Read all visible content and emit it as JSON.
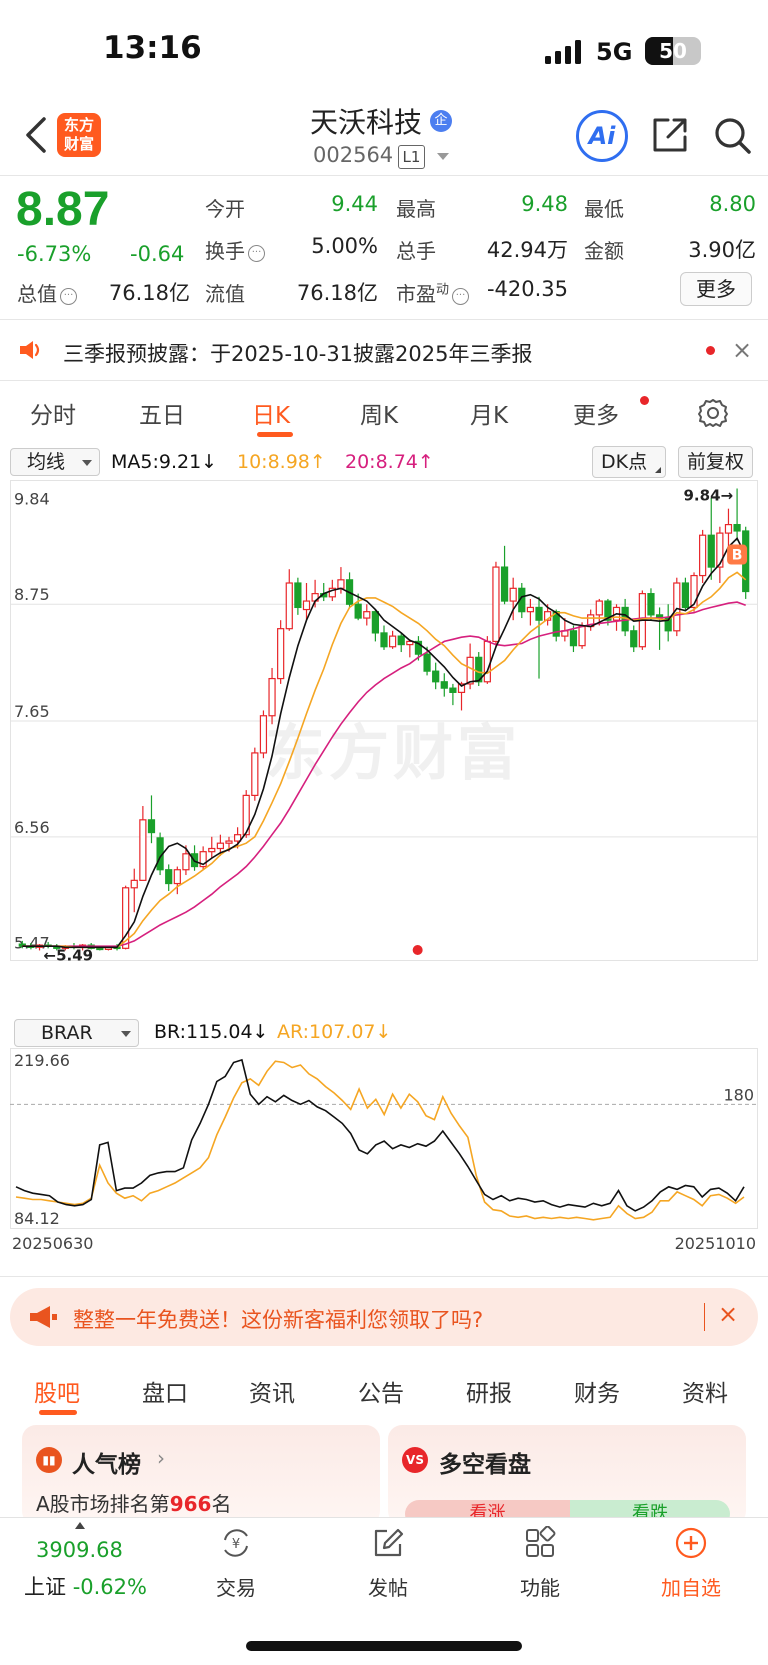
{
  "status_bar": {
    "time": "13:16",
    "network": "5G",
    "battery": "50",
    "battery_level": 0.5
  },
  "header": {
    "back_label": "",
    "logo_text": "东方\n财富",
    "stock_name": "天沃科技",
    "stock_badge": "企",
    "stock_code": "002564",
    "level_badge": "L1",
    "ai_label": "Ai"
  },
  "quote": {
    "price": "8.87",
    "change_pct": "-6.73%",
    "change_val": "-0.64",
    "fields": [
      {
        "label": "今开",
        "value": "9.44",
        "green": true
      },
      {
        "label": "最高",
        "value": "9.48",
        "green": true
      },
      {
        "label": "最低",
        "value": "8.80",
        "green": true
      },
      {
        "label": "换手",
        "value": "5.00%",
        "green": false,
        "info": true
      },
      {
        "label": "总手",
        "value": "42.94万",
        "green": false
      },
      {
        "label": "金额",
        "value": "3.90亿",
        "green": false
      },
      {
        "label": "总值",
        "value": "76.18亿",
        "green": false,
        "info": true
      },
      {
        "label": "流值",
        "value": "76.18亿",
        "green": false
      },
      {
        "label": "市盈",
        "sup": "动",
        "value": "-420.35",
        "green": false,
        "info": true
      }
    ],
    "more_label": "更多"
  },
  "notice": {
    "text": "三季报预披露：于2025-10-31披露2025年三季报",
    "close": "×"
  },
  "period_tabs": [
    "分时",
    "五日",
    "日K",
    "周K",
    "月K",
    "更多"
  ],
  "ma_legend": {
    "select": "均线",
    "ma5": "MA5:9.21↓",
    "ma10": "10:8.98↑",
    "ma20": "20:8.74↑",
    "dk_label": "DK点",
    "fq_label": "前复权"
  },
  "colors": {
    "up": "#e8262a",
    "down": "#1aa02b",
    "ma5": "#111111",
    "ma10": "#f5a623",
    "ma20": "#d6207e",
    "accent": "#ff5a1f",
    "br": "#111111",
    "ar": "#f5a623"
  },
  "chart_data": [
    {
      "type": "candlestick",
      "title": "",
      "y_ticks": [
        "9.84",
        "8.75",
        "7.65",
        "6.56",
        "5.47"
      ],
      "ylim": [
        5.4,
        9.92
      ],
      "annotations": {
        "high_label": "9.84→",
        "low_label": "←5.49",
        "buy_marker": "B"
      },
      "candles_ohlc": [
        [
          5.55,
          5.58,
          5.51,
          5.53
        ],
        [
          5.53,
          5.56,
          5.5,
          5.52
        ],
        [
          5.52,
          5.55,
          5.49,
          5.54
        ],
        [
          5.54,
          5.57,
          5.51,
          5.53
        ],
        [
          5.53,
          5.55,
          5.49,
          5.51
        ],
        [
          5.51,
          5.54,
          5.49,
          5.53
        ],
        [
          5.53,
          5.56,
          5.5,
          5.52
        ],
        [
          5.52,
          5.55,
          5.49,
          5.54
        ],
        [
          5.54,
          5.56,
          5.5,
          5.51
        ],
        [
          5.51,
          5.53,
          5.49,
          5.5
        ],
        [
          5.5,
          5.53,
          5.49,
          5.52
        ],
        [
          5.52,
          5.55,
          5.49,
          5.51
        ],
        [
          5.51,
          6.1,
          5.5,
          6.08
        ],
        [
          6.08,
          6.26,
          5.85,
          6.15
        ],
        [
          6.15,
          6.85,
          6.15,
          6.72
        ],
        [
          6.72,
          6.95,
          6.5,
          6.6
        ],
        [
          6.55,
          6.6,
          6.2,
          6.25
        ],
        [
          6.25,
          6.3,
          6.05,
          6.12
        ],
        [
          6.12,
          6.28,
          6.02,
          6.25
        ],
        [
          6.25,
          6.48,
          6.2,
          6.4
        ],
        [
          6.4,
          6.48,
          6.24,
          6.28
        ],
        [
          6.28,
          6.47,
          6.25,
          6.42
        ],
        [
          6.42,
          6.56,
          6.36,
          6.45
        ],
        [
          6.45,
          6.58,
          6.38,
          6.5
        ],
        [
          6.5,
          6.56,
          6.42,
          6.52
        ],
        [
          6.52,
          6.65,
          6.45,
          6.58
        ],
        [
          6.58,
          7.0,
          6.55,
          6.95
        ],
        [
          6.95,
          7.4,
          6.9,
          7.35
        ],
        [
          7.35,
          7.75,
          7.3,
          7.7
        ],
        [
          7.7,
          8.15,
          7.62,
          8.05
        ],
        [
          8.05,
          8.6,
          8.0,
          8.52
        ],
        [
          8.52,
          9.08,
          8.5,
          8.95
        ],
        [
          8.95,
          9.0,
          8.65,
          8.72
        ],
        [
          8.7,
          8.95,
          8.6,
          8.78
        ],
        [
          8.78,
          8.98,
          8.72,
          8.85
        ],
        [
          8.85,
          8.95,
          8.78,
          8.82
        ],
        [
          8.82,
          8.98,
          8.78,
          8.9
        ],
        [
          8.9,
          9.1,
          8.85,
          8.98
        ],
        [
          8.98,
          9.05,
          8.72,
          8.75
        ],
        [
          8.75,
          8.85,
          8.6,
          8.62
        ],
        [
          8.62,
          8.75,
          8.55,
          8.68
        ],
        [
          8.68,
          8.7,
          8.4,
          8.48
        ],
        [
          8.48,
          8.55,
          8.32,
          8.35
        ],
        [
          8.35,
          8.5,
          8.33,
          8.45
        ],
        [
          8.45,
          8.48,
          8.3,
          8.37
        ],
        [
          8.37,
          8.42,
          8.25,
          8.4
        ],
        [
          8.4,
          8.45,
          8.22,
          8.28
        ],
        [
          8.28,
          8.35,
          8.08,
          8.12
        ],
        [
          8.12,
          8.2,
          7.95,
          8.02
        ],
        [
          8.02,
          8.1,
          7.88,
          7.96
        ],
        [
          7.96,
          8.0,
          7.8,
          7.92
        ],
        [
          7.92,
          8.02,
          7.75,
          8.0
        ],
        [
          8.0,
          8.38,
          7.95,
          8.25
        ],
        [
          8.25,
          8.3,
          7.98,
          8.02
        ],
        [
          8.02,
          8.45,
          8.0,
          8.4
        ],
        [
          8.4,
          9.15,
          8.35,
          9.1
        ],
        [
          9.1,
          9.3,
          8.75,
          8.78
        ],
        [
          8.78,
          9.0,
          8.6,
          8.9
        ],
        [
          8.9,
          8.95,
          8.62,
          8.68
        ],
        [
          8.68,
          8.8,
          8.55,
          8.72
        ],
        [
          8.72,
          8.82,
          8.05,
          8.6
        ],
        [
          8.6,
          8.75,
          8.55,
          8.68
        ],
        [
          8.68,
          8.7,
          8.4,
          8.45
        ],
        [
          8.45,
          8.62,
          8.4,
          8.5
        ],
        [
          8.5,
          8.55,
          8.3,
          8.36
        ],
        [
          8.36,
          8.58,
          8.33,
          8.54
        ],
        [
          8.54,
          8.7,
          8.5,
          8.65
        ],
        [
          8.65,
          8.8,
          8.55,
          8.78
        ],
        [
          8.78,
          8.8,
          8.55,
          8.6
        ],
        [
          8.6,
          8.75,
          8.5,
          8.72
        ],
        [
          8.72,
          8.8,
          8.45,
          8.5
        ],
        [
          8.5,
          8.55,
          8.3,
          8.35
        ],
        [
          8.35,
          8.88,
          8.32,
          8.85
        ],
        [
          8.85,
          8.9,
          8.6,
          8.65
        ],
        [
          8.65,
          8.72,
          8.32,
          8.62
        ],
        [
          8.62,
          8.75,
          8.4,
          8.5
        ],
        [
          8.5,
          9.0,
          8.45,
          8.95
        ],
        [
          8.95,
          9.0,
          8.7,
          8.72
        ],
        [
          8.72,
          9.05,
          8.68,
          9.02
        ],
        [
          9.02,
          9.45,
          8.95,
          9.4
        ],
        [
          9.4,
          9.75,
          8.98,
          9.1
        ],
        [
          9.1,
          9.48,
          8.95,
          9.42
        ],
        [
          9.42,
          9.65,
          9.2,
          9.5
        ],
        [
          9.5,
          9.84,
          9.35,
          9.44
        ],
        [
          9.44,
          9.48,
          8.8,
          8.87
        ]
      ],
      "ma5": [
        5.53,
        5.53,
        5.53,
        5.53,
        5.53,
        5.52,
        5.52,
        5.52,
        5.52,
        5.52,
        5.52,
        5.52,
        5.63,
        5.76,
        6.0,
        6.2,
        6.37,
        6.47,
        6.5,
        6.45,
        6.33,
        6.3,
        6.36,
        6.41,
        6.44,
        6.49,
        6.6,
        6.77,
        7.01,
        7.32,
        7.72,
        8.06,
        8.36,
        8.6,
        8.78,
        8.85,
        8.88,
        8.9,
        8.86,
        8.82,
        8.78,
        8.7,
        8.6,
        8.54,
        8.48,
        8.41,
        8.38,
        8.32,
        8.24,
        8.16,
        8.06,
        7.98,
        8.02,
        8.03,
        8.12,
        8.35,
        8.52,
        8.7,
        8.82,
        8.84,
        8.8,
        8.72,
        8.67,
        8.6,
        8.56,
        8.55,
        8.54,
        8.58,
        8.62,
        8.66,
        8.65,
        8.59,
        8.6,
        8.6,
        8.59,
        8.6,
        8.71,
        8.69,
        8.75,
        8.92,
        9.04,
        9.13,
        9.29,
        9.37,
        9.21
      ],
      "ma10": [
        5.53,
        5.53,
        5.53,
        5.53,
        5.53,
        5.53,
        5.52,
        5.52,
        5.52,
        5.52,
        5.52,
        5.52,
        5.58,
        5.65,
        5.77,
        5.87,
        5.96,
        6.02,
        6.09,
        6.14,
        6.19,
        6.25,
        6.31,
        6.39,
        6.45,
        6.47,
        6.5,
        6.56,
        6.71,
        6.88,
        7.06,
        7.27,
        7.49,
        7.72,
        7.94,
        8.14,
        8.37,
        8.57,
        8.72,
        8.78,
        8.81,
        8.81,
        8.77,
        8.73,
        8.67,
        8.62,
        8.57,
        8.5,
        8.42,
        8.36,
        8.27,
        8.19,
        8.15,
        8.11,
        8.1,
        8.16,
        8.22,
        8.32,
        8.41,
        8.49,
        8.55,
        8.61,
        8.67,
        8.67,
        8.64,
        8.62,
        8.62,
        8.62,
        8.62,
        8.63,
        8.62,
        8.6,
        8.61,
        8.62,
        8.61,
        8.6,
        8.67,
        8.66,
        8.7,
        8.77,
        8.82,
        8.9,
        9.0,
        9.05,
        8.98
      ],
      "ma20": [
        5.53,
        5.53,
        5.53,
        5.53,
        5.53,
        5.53,
        5.53,
        5.53,
        5.53,
        5.53,
        5.53,
        5.53,
        5.55,
        5.58,
        5.63,
        5.68,
        5.73,
        5.77,
        5.81,
        5.85,
        5.9,
        5.96,
        6.02,
        6.09,
        6.15,
        6.21,
        6.28,
        6.37,
        6.47,
        6.58,
        6.69,
        6.82,
        6.96,
        7.1,
        7.24,
        7.37,
        7.5,
        7.62,
        7.73,
        7.83,
        7.92,
        7.99,
        8.05,
        8.1,
        8.15,
        8.19,
        8.25,
        8.3,
        8.35,
        8.4,
        8.42,
        8.44,
        8.45,
        8.44,
        8.4,
        8.37,
        8.36,
        8.37,
        8.38,
        8.42,
        8.45,
        8.47,
        8.49,
        8.5,
        8.52,
        8.54,
        8.56,
        8.57,
        8.58,
        8.59,
        8.6,
        8.61,
        8.62,
        8.62,
        8.62,
        8.63,
        8.65,
        8.66,
        8.67,
        8.7,
        8.72,
        8.74,
        8.76,
        8.77,
        8.74
      ]
    },
    {
      "type": "line",
      "title": "",
      "indicator": "BRAR",
      "legend": {
        "br": "BR:115.04↓",
        "ar": "AR:107.07↓"
      },
      "y_ticks_top": "219.66",
      "y_ticks_bottom": "84.12",
      "reference_value": "180",
      "reference_line": 180,
      "ylim": [
        84.12,
        219.66
      ],
      "x_start": "20250630",
      "x_end": "20251010",
      "br": [
        115,
        112,
        110,
        109,
        108,
        103,
        101,
        100,
        101,
        105,
        148,
        150,
        112,
        114,
        114,
        118,
        124,
        126,
        127,
        127,
        130,
        152,
        165,
        180,
        198,
        202,
        213,
        215,
        188,
        180,
        186,
        182,
        187,
        183,
        180,
        183,
        178,
        175,
        170,
        165,
        157,
        144,
        141,
        148,
        151,
        145,
        148,
        146,
        149,
        147,
        151,
        159,
        150,
        141,
        131,
        120,
        109,
        105,
        108,
        104,
        106,
        105,
        103,
        104,
        101,
        99,
        101,
        100,
        99,
        102,
        100,
        102,
        112,
        100,
        96,
        99,
        104,
        111,
        115,
        113,
        116,
        115,
        107,
        113,
        114,
        110,
        104,
        115
      ],
      "ar": [
        107,
        106,
        105,
        105,
        104,
        103,
        102,
        101,
        102,
        106,
        132,
        118,
        110,
        106,
        108,
        104,
        110,
        112,
        115,
        118,
        122,
        126,
        130,
        138,
        156,
        170,
        185,
        197,
        200,
        195,
        206,
        214,
        213,
        209,
        211,
        204,
        200,
        194,
        189,
        183,
        176,
        192,
        177,
        184,
        172,
        188,
        177,
        188,
        182,
        171,
        168,
        186,
        173,
        163,
        154,
        124,
        103,
        97,
        96,
        92,
        91,
        92,
        90,
        91,
        90,
        91,
        90,
        91,
        90,
        89,
        90,
        91,
        100,
        94,
        90,
        91,
        95,
        104,
        104,
        111,
        108,
        105,
        100,
        108,
        109,
        106,
        102,
        107
      ]
    }
  ],
  "ad_banner": {
    "text": "整整一年免费送！这份新客福利您领取了吗?",
    "close": "×"
  },
  "bottom_tabs": [
    "股吧",
    "盘口",
    "资讯",
    "公告",
    "研报",
    "财务",
    "资料"
  ],
  "cards": {
    "popular": {
      "title": "人气榜",
      "sub_prefix": "A股市场排名第",
      "rank": "966",
      "sub_suffix": "名"
    },
    "bull_bear": {
      "title": "多空看盘",
      "vote_up": "看涨",
      "vote_down": "看跌"
    }
  },
  "bottom_nav": {
    "index_value": "3909.68",
    "index_name": "上证",
    "index_pct": "-0.62%",
    "items": [
      {
        "label": "交易",
        "icon": "yuan-exchange-icon"
      },
      {
        "label": "发帖",
        "icon": "edit-icon"
      },
      {
        "label": "功能",
        "icon": "grid-icon"
      },
      {
        "label": "加自选",
        "icon": "plus-circle-icon"
      }
    ]
  },
  "watermark": "东方财富"
}
